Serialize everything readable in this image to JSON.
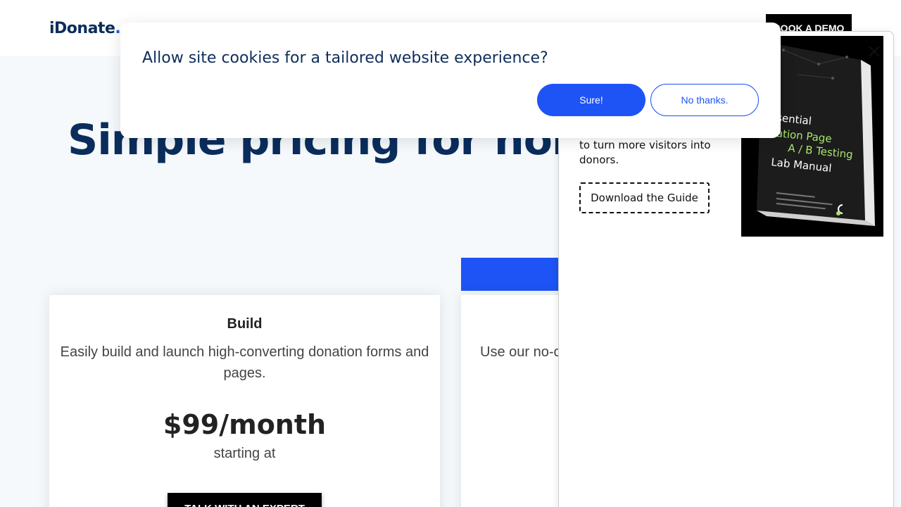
{
  "header": {
    "logo_text": "iDonate",
    "logo_dot": ".",
    "demo_label": "BOOK A DEMO"
  },
  "hero": {
    "title": "Simple pricing for nonpro"
  },
  "cards": {
    "build": {
      "title": "Build",
      "description": "Easily build and launch high-converting donation forms and pages.",
      "price": "$99/month",
      "price_note": "starting at",
      "button_label": "TALK WITH AN EXPERT"
    },
    "second": {
      "description": "Use our no-c"
    }
  },
  "side_panel": {
    "text": "to turn more visitors into donors.",
    "guide_button": "Download the Guide",
    "book": {
      "line1": "ssential",
      "line2": "nation Page",
      "line3": "A / B Testing",
      "line4": "Lab Manual"
    },
    "close_icon": "close-icon"
  },
  "cookie_banner": {
    "message": "Allow site cookies for a tailored website experience?",
    "accept_label": "Sure!",
    "decline_label": "No thanks."
  },
  "colors": {
    "brand_navy": "#0a2d5c",
    "accent_blue": "#1e54f5",
    "book_green": "#a8e66b"
  }
}
